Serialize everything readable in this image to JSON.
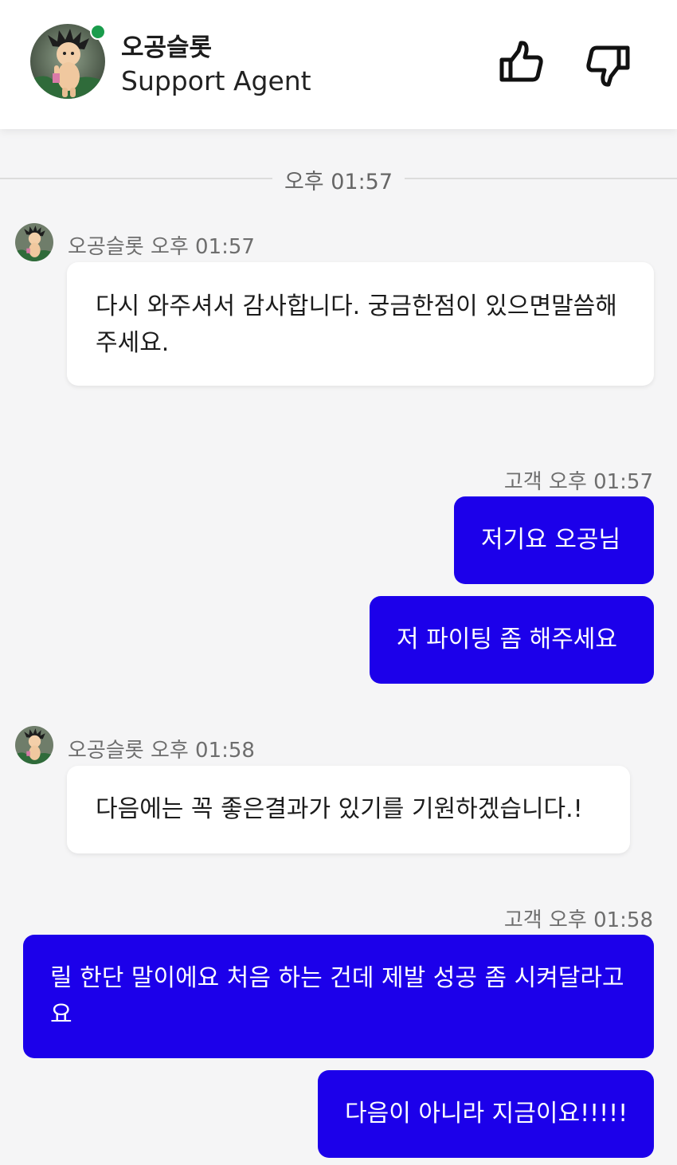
{
  "header": {
    "agent_name": "오공슬롯",
    "agent_role": "Support Agent",
    "status_color": "#1a9c4c",
    "like_icon": "thumbs-up-icon",
    "dislike_icon": "thumbs-down-icon"
  },
  "divider": {
    "time": "오후 01:57"
  },
  "messages": [
    {
      "sender": "agent",
      "meta": "오공슬롯 오후 01:57",
      "text": "다시 와주셔서 감사합니다. 궁금한점이 있으면말씀해주세요."
    },
    {
      "sender": "user",
      "meta": "고객 오후 01:57",
      "text": "저기요 오공님"
    },
    {
      "sender": "user",
      "text": "저 파이팅 좀 해주세요"
    },
    {
      "sender": "agent",
      "meta": "오공슬롯 오후 01:58",
      "text": "다음에는 꼭 좋은결과가 있기를 기원하겠습니다.!"
    },
    {
      "sender": "user",
      "meta": "고객 오후 01:58",
      "text": "릴 한단 말이에요 처음 하는 건데 제발 성공 좀 시켜달라고요"
    },
    {
      "sender": "user",
      "text": "다음이 아니라 지금이요!!!!!"
    }
  ],
  "colors": {
    "user_bubble": "#1c00ea",
    "agent_bubble": "#ffffff",
    "background": "#f5f5f6"
  }
}
